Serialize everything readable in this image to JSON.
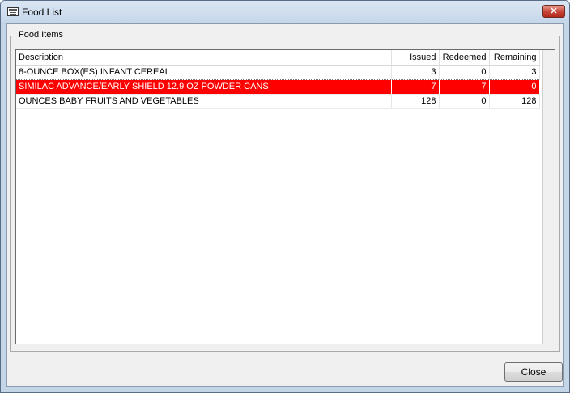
{
  "window": {
    "title": "Food List",
    "close_glyph": "✕"
  },
  "group": {
    "legend": "Food Items"
  },
  "table": {
    "columns": [
      "Description",
      "Issued",
      "Redeemed",
      "Remaining"
    ],
    "rows": [
      {
        "description": "8-OUNCE BOX(ES) INFANT CEREAL",
        "issued": "3",
        "redeemed": "0",
        "remaining": "3"
      },
      {
        "description": "SIMILAC ADVANCE/EARLY SHIELD 12.9 OZ POWDER CANS",
        "issued": "7",
        "redeemed": "7",
        "remaining": "0"
      },
      {
        "description": "OUNCES BABY FRUITS AND VEGETABLES",
        "issued": "128",
        "redeemed": "0",
        "remaining": "128"
      }
    ],
    "highlight_color": "#ff0000"
  },
  "buttons": {
    "close_label": "Close"
  },
  "icons": {
    "app": "app-window-icon",
    "close": "close-icon"
  }
}
